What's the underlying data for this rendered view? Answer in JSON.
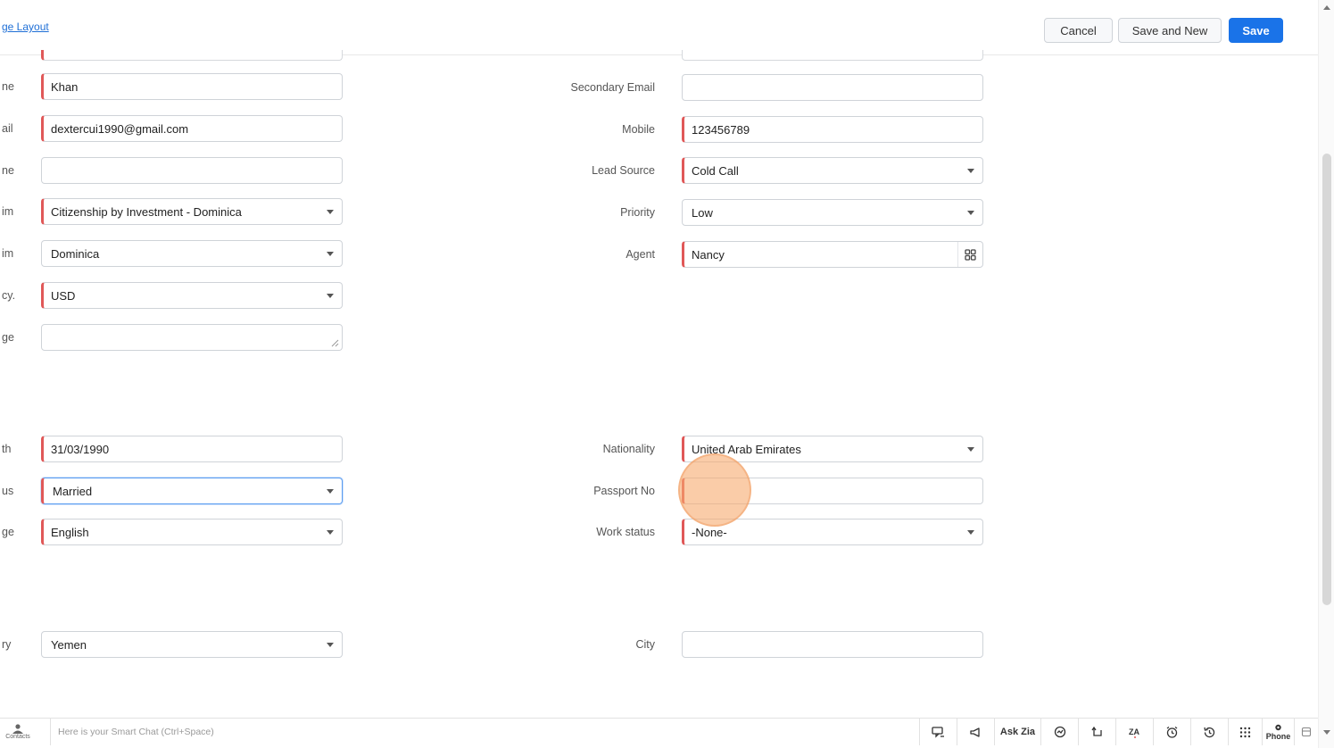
{
  "header": {
    "layout_link": "ge Layout",
    "cancel_label": "Cancel",
    "save_new_label": "Save and New",
    "save_label": "Save"
  },
  "left_fields": [
    {
      "label": "ne",
      "value": "Khan"
    },
    {
      "label": "ail",
      "value": "dextercui1990@gmail.com"
    },
    {
      "label": "ne",
      "value": ""
    },
    {
      "label": "im",
      "value": "Citizenship by Investment - Dominica"
    },
    {
      "label": "im",
      "value": "Dominica"
    },
    {
      "label": "cy.",
      "value": "USD"
    },
    {
      "label": "ge",
      "value": ""
    },
    {
      "label": "th",
      "value": "31/03/1990"
    },
    {
      "label": "us",
      "value": "Married"
    },
    {
      "label": "ge",
      "value": "English"
    },
    {
      "label": "ry",
      "value": "Yemen"
    }
  ],
  "right_fields": [
    {
      "label": "Secondary Email",
      "value": ""
    },
    {
      "label": "Mobile",
      "value": "123456789"
    },
    {
      "label": "Lead Source",
      "value": "Cold Call"
    },
    {
      "label": "Priority",
      "value": "Low"
    },
    {
      "label": "Agent",
      "value": "Nancy"
    },
    {
      "label": "Nationality",
      "value": "United Arab Emirates"
    },
    {
      "label": "Passport No",
      "value": ""
    },
    {
      "label": "Work status",
      "value": "-None-"
    },
    {
      "label": "City",
      "value": ""
    }
  ],
  "bottom_bar": {
    "contacts_label": "Contacts",
    "smart_chat_placeholder": "Here is your Smart Chat (Ctrl+Space)",
    "ask_zia_label": "Ask Zia",
    "phone_label": "Phone"
  },
  "colors": {
    "primary": "#1a73e8",
    "required_marker": "#e05858",
    "click_highlight": "#f6aa6e"
  }
}
